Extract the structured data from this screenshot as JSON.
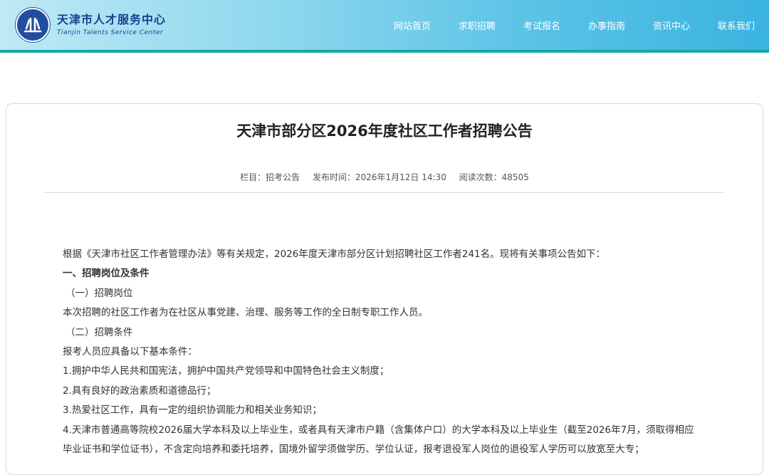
{
  "site": {
    "name_cn": "天津市人才服务中心",
    "name_en": "Tianjin Talents Service Center"
  },
  "nav": [
    "网站首页",
    "求职招聘",
    "考试报名",
    "办事指南",
    "资讯中心",
    "联系我们"
  ],
  "article": {
    "title": "天津市部分区2026年度社区工作者招聘公告",
    "meta": {
      "column": "栏目：招考公告",
      "published": "发布时间：2026年1月12日 14:30",
      "views": "阅读次数：48505"
    },
    "paragraphs": [
      "根据《天津市社区工作者管理办法》等有关规定，2026年度天津市部分区计划招聘社区工作者241名。现将有关事项公告如下：",
      "一、招聘岗位及条件",
      "（一）招聘岗位",
      "本次招聘的社区工作者为在社区从事党建、治理、服务等工作的全日制专职工作人员。",
      "（二）招聘条件",
      "报考人员应具备以下基本条件：",
      "1.拥护中华人民共和国宪法，拥护中国共产党领导和中国特色社会主义制度；",
      "2.具有良好的政治素质和道德品行；",
      "3.热爱社区工作，具有一定的组织协调能力和相关业务知识；",
      "4.天津市普通高等院校2026届大学本科及以上毕业生，或者具有天津市户籍（含集体户口）的大学本科及以上毕业生（截至2026年7月，须取得相应",
      "毕业证书和学位证书），不含定向培养和委托培养，国境外留学须做学历、学位认证，报考退役军人岗位的退役军人学历可以放宽至大专；"
    ]
  }
}
